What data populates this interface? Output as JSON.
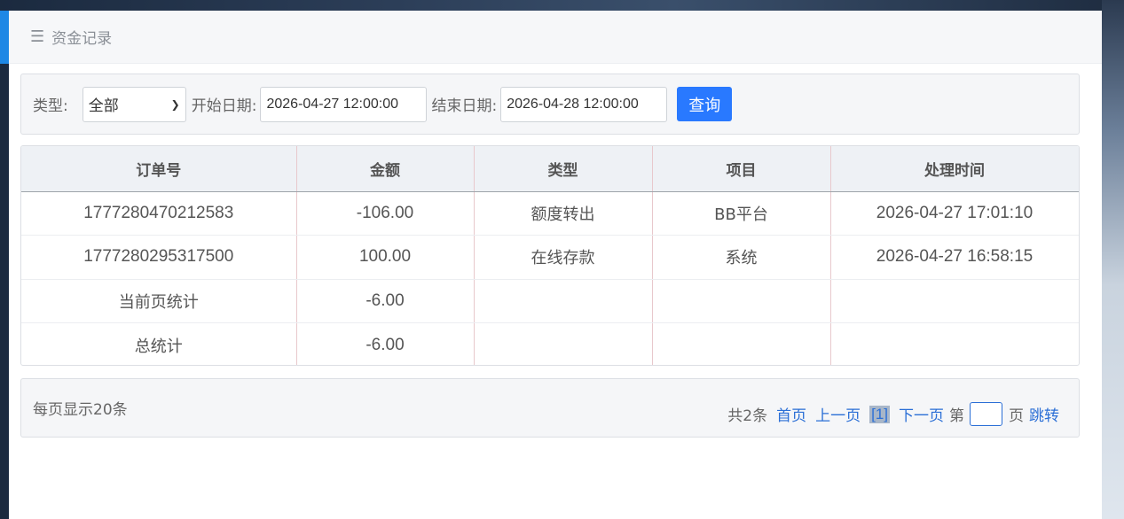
{
  "header": {
    "title": "资金记录",
    "icon": "menu-icon"
  },
  "filters": {
    "type_label": "类型:",
    "type_value": "全部",
    "start_label": "开始日期:",
    "start_value": "2026-04-27 12:00:00",
    "end_label": "结束日期:",
    "end_value": "2026-04-28 12:00:00",
    "query_label": "查询"
  },
  "table": {
    "columns": [
      "订单号",
      "金额",
      "类型",
      "项目",
      "处理时间"
    ],
    "rows": [
      [
        "1777280470212583",
        "-106.00",
        "额度转出",
        "BB平台",
        "2026-04-27 17:01:10"
      ],
      [
        "1777280295317500",
        "100.00",
        "在线存款",
        "系统",
        "2026-04-27 16:58:15"
      ],
      [
        "当前页统计",
        "-6.00",
        "",
        "",
        ""
      ],
      [
        "总统计",
        "-6.00",
        "",
        "",
        ""
      ]
    ]
  },
  "pager": {
    "per_page": "每页显示20条",
    "total": "共2条",
    "first": "首页",
    "prev": "上一页",
    "current": "[1]",
    "next": "下一页",
    "page_prefix": "第",
    "page_suffix": "页",
    "jump": "跳转"
  },
  "colors": {
    "accent": "#1e88e5",
    "button": "#2979ff",
    "link": "#2b6fd6"
  }
}
